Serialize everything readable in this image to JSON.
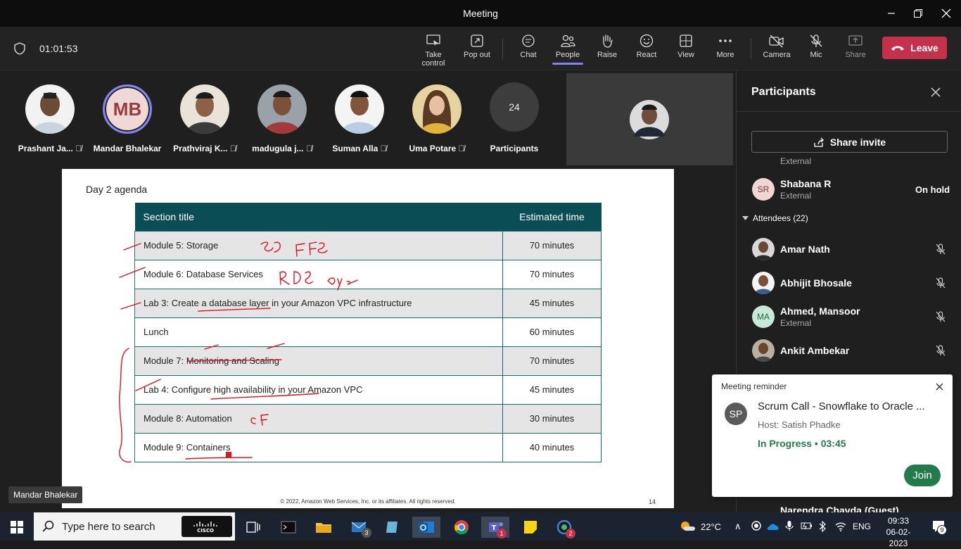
{
  "window": {
    "title": "Meeting"
  },
  "toolbar": {
    "timer": "01:01:53",
    "buttons": {
      "take_control": "Take control",
      "pop_out": "Pop out",
      "chat": "Chat",
      "people": "People",
      "raise": "Raise",
      "react": "React",
      "view": "View",
      "more": "More",
      "camera": "Camera",
      "mic": "Mic",
      "share": "Share"
    },
    "leave": "Leave"
  },
  "participants_strip": [
    {
      "name": "Prashant Ja...",
      "initials": ""
    },
    {
      "name": "Mandar Bhalekar",
      "initials": "MB"
    },
    {
      "name": "Prathviraj K...",
      "initials": ""
    },
    {
      "name": "madugula j...",
      "initials": ""
    },
    {
      "name": "Suman Alla",
      "initials": ""
    },
    {
      "name": "Uma Potare",
      "initials": ""
    },
    {
      "name": "Participants",
      "initials": "24"
    }
  ],
  "slide": {
    "heading": "Day 2 agenda",
    "columns": [
      "Section title",
      "Estimated time"
    ],
    "rows": [
      {
        "title": "Module 5: Storage",
        "time": "70 minutes"
      },
      {
        "title": "Module 6: Database Services",
        "time": "70 minutes"
      },
      {
        "title": "Lab 3: Create a database layer in your Amazon VPC infrastructure",
        "time": "45 minutes"
      },
      {
        "title": "Lunch",
        "time": "60 minutes"
      },
      {
        "title": "Module 7: Monitoring and Scaling",
        "time": "70 minutes"
      },
      {
        "title": "Lab 4: Configure high availability in your Amazon VPC",
        "time": "45 minutes"
      },
      {
        "title": "Module 8: Automation",
        "time": "30 minutes"
      },
      {
        "title": "Module 9: Containers",
        "time": "40 minutes"
      }
    ],
    "footer": "© 2022, Amazon Web Services, Inc. or its affiliates. All rights reserved.",
    "page": "14"
  },
  "speaker_label": "Mandar Bhalekar",
  "panel": {
    "title": "Participants",
    "share_invite": "Share invite",
    "partial_row_sub": "External",
    "shabana": {
      "initials": "SR",
      "name": "Shabana R",
      "sub": "External",
      "status": "On hold"
    },
    "attendees_header": "Attendees (22)",
    "attendees": [
      {
        "name": "Amar Nath",
        "sub": ""
      },
      {
        "name": "Abhijit Bhosale",
        "sub": ""
      },
      {
        "name": "Ahmed, Mansoor",
        "sub": "External",
        "initials": "MA"
      },
      {
        "name": "Ankit Ambekar",
        "sub": ""
      }
    ],
    "bottom_partial": "Narendra Chavda (Guest)"
  },
  "reminder": {
    "header": "Meeting reminder",
    "initials": "SP",
    "title": "Scrum Call - Snowflake to Oracle ...",
    "host": "Host: Satish Phadke",
    "status": "In Progress • 03:45",
    "join": "Join"
  },
  "taskbar": {
    "search_placeholder": "Type here to search",
    "weather": "22°C",
    "lang": "ENG",
    "time": "09:33",
    "date": "06-02-2023",
    "mail_badge": "3",
    "teams_badge": "1",
    "app_badge": "2",
    "notif_badge": "9"
  },
  "colors": {
    "accent": "#7f85f5",
    "leave": "#c4314b",
    "slide_header": "#0b4d55",
    "in_progress": "#237b4b"
  }
}
